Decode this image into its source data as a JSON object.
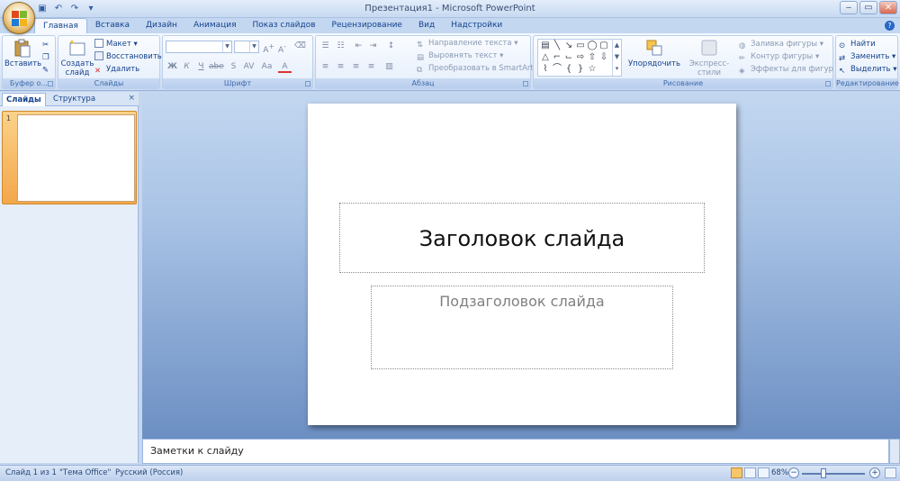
{
  "window": {
    "title": "Презентация1 - Microsoft PowerPoint",
    "controls": [
      "‒",
      "▭",
      "✕"
    ]
  },
  "quick_access": {
    "icons": [
      "save-icon",
      "undo-icon",
      "redo-icon",
      "customize-icon"
    ]
  },
  "ribbon_tabs": [
    {
      "label": "Главная",
      "active": true
    },
    {
      "label": "Вставка"
    },
    {
      "label": "Дизайн"
    },
    {
      "label": "Анимация"
    },
    {
      "label": "Показ слайдов"
    },
    {
      "label": "Рецензирование"
    },
    {
      "label": "Вид"
    },
    {
      "label": "Надстройки"
    }
  ],
  "ribbon": {
    "clipboard": {
      "label": "Буфер о...",
      "paste": "Вставить"
    },
    "slides": {
      "label": "Слайды",
      "new_slide": "Создать слайд",
      "layout": "Макет",
      "reset": "Восстановить",
      "delete": "Удалить"
    },
    "font": {
      "label": "Шрифт",
      "buttons": [
        "Ж",
        "К",
        "Ч",
        "abe",
        "S",
        "AV",
        "Aa",
        "A"
      ]
    },
    "paragraph": {
      "label": "Абзац",
      "text_direction": "Направление текста",
      "align_text": "Выровнять текст",
      "convert_smartart": "Преобразовать в SmartArt"
    },
    "drawing": {
      "label": "Рисование",
      "arrange": "Упорядочить",
      "quick_styles": "Экспресс-стили",
      "shape_fill": "Заливка фигуры",
      "shape_outline": "Контур фигуры",
      "shape_effects": "Эффекты для фигур"
    },
    "editing": {
      "label": "Редактирование",
      "find": "Найти",
      "replace": "Заменить",
      "select": "Выделить"
    }
  },
  "left_pane": {
    "tabs": [
      "Слайды",
      "Структура"
    ],
    "active_tab": "Слайды",
    "close": "×",
    "slide_number": "1"
  },
  "slide": {
    "title_placeholder": "Заголовок слайда",
    "subtitle_placeholder": "Подзаголовок слайда"
  },
  "notes": {
    "placeholder": "Заметки к слайду"
  },
  "status_bar": {
    "slide_info": "Слайд 1 из 1",
    "theme": "\"Тема Office\"",
    "language": "Русский (Россия)",
    "zoom": "68%"
  },
  "colors": {
    "accent": "#15428b",
    "ribbon_bg": "#dfeaf9",
    "selection": "#f3a74a"
  }
}
